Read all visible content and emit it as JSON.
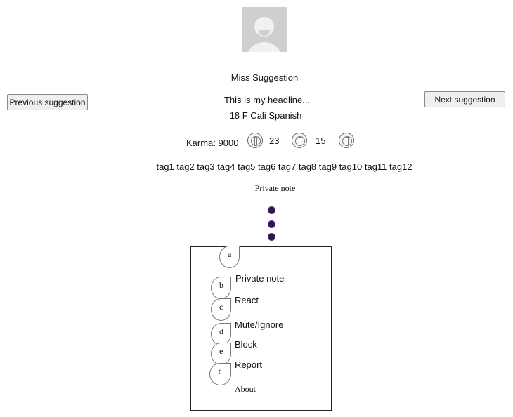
{
  "profile": {
    "name": "Miss Suggestion",
    "headline": "This is my headline...",
    "details": "18 F Cali Spanish",
    "karma_label": "Karma: 9000",
    "count_a": "23",
    "count_b": "15",
    "tags": "tag1 tag2 tag3 tag4 tag5 tag6 tag7 tag8 tag9 tag10 tag11 tag12",
    "private_note_label": "Private note"
  },
  "nav": {
    "previous_label": "Previous suggestion",
    "next_label": "Next suggestion"
  },
  "menu": {
    "items": [
      {
        "letter": "a",
        "label": ""
      },
      {
        "letter": "b",
        "label": "Private note"
      },
      {
        "letter": "c",
        "label": "React"
      },
      {
        "letter": "d",
        "label": "Mute/Ignore"
      },
      {
        "letter": "e",
        "label": "Block"
      },
      {
        "letter": "f",
        "label": "Report"
      }
    ],
    "about_label": "About"
  },
  "icons": {
    "avatar": "default-avatar-icon",
    "karma_icons": [
      "karma-icon",
      "karma-icon",
      "karma-icon"
    ],
    "dots": "more-options-icon"
  },
  "colors": {
    "dot": "#2a1a4a",
    "avatar_bg": "#cfcfcf"
  }
}
